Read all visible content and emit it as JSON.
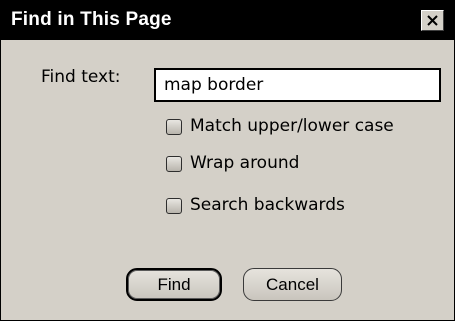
{
  "dialog": {
    "title": "Find in This Page",
    "close_icon": "close-icon"
  },
  "find": {
    "label": "Find text:",
    "value": "map border"
  },
  "options": [
    {
      "label": "Match upper/lower case",
      "checked": false
    },
    {
      "label": "Wrap around",
      "checked": false
    },
    {
      "label": "Search backwards",
      "checked": false
    }
  ],
  "buttons": {
    "find": "Find",
    "cancel": "Cancel"
  }
}
